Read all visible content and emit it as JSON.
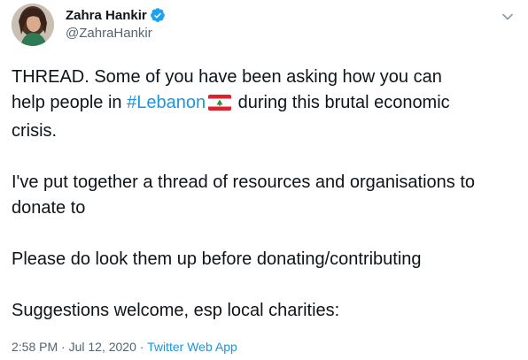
{
  "author": {
    "display_name": "Zahra Hankir",
    "handle": "@ZahraHankir",
    "verified": true
  },
  "tweet": {
    "line1_prefix": "THREAD. Some of you have been asking how you can",
    "line2_prefix": "help people in ",
    "hashtag": "#Lebanon",
    "flag_icon": "lebanon-flag-icon",
    "line2_suffix": " during this brutal economic",
    "line3": "crisis.",
    "paragraph2": "I've put together a thread of resources and organisations to donate to",
    "paragraph3": "Please do look them up before donating/contributing",
    "paragraph4": "Suggestions welcome, esp local charities:"
  },
  "meta": {
    "time": "2:58 PM",
    "separator": " · ",
    "date": "Jul 12, 2020",
    "separator2": " · ",
    "source": "Twitter Web App"
  },
  "colors": {
    "link": "#1b95e0",
    "verified": "#1da1f2",
    "secondary_text": "#536471",
    "primary_text": "#0f1419"
  }
}
